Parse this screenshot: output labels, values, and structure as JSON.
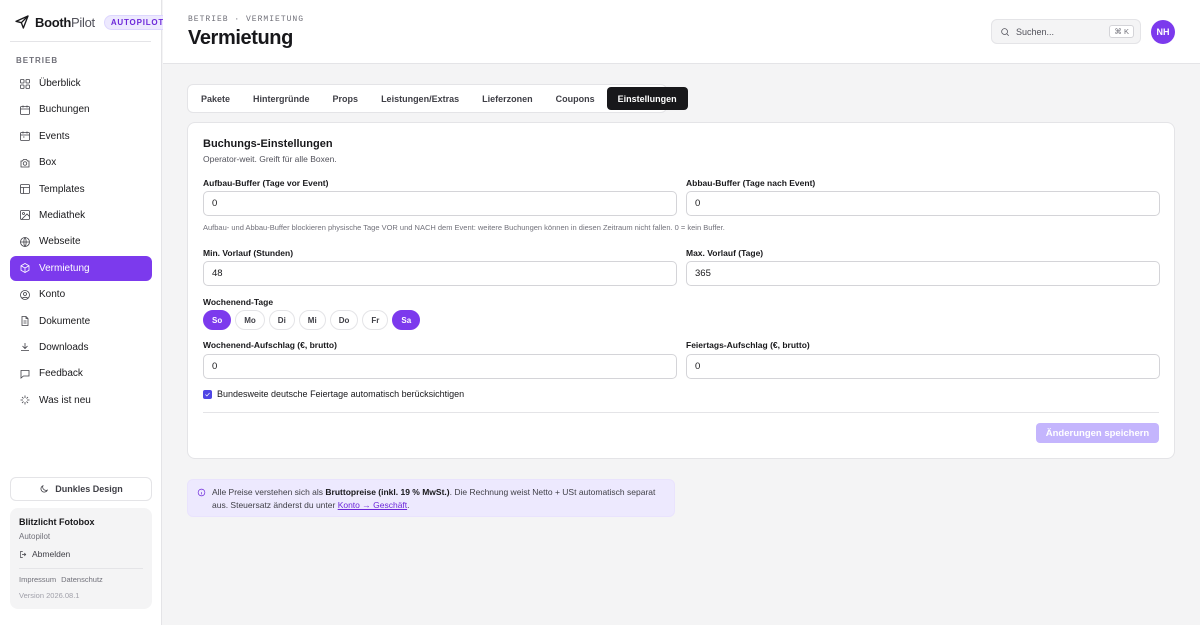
{
  "brand": {
    "name_strong": "Booth",
    "name_light": "Pilot",
    "badge": "AUTOPILOT"
  },
  "sidebar": {
    "section": "BETRIEB",
    "items": [
      {
        "label": "Überblick",
        "icon": "layout-grid-icon",
        "active": false
      },
      {
        "label": "Buchungen",
        "icon": "calendar-icon",
        "active": false
      },
      {
        "label": "Events",
        "icon": "calendar-event-icon",
        "active": false
      },
      {
        "label": "Box",
        "icon": "camera-icon",
        "active": false
      },
      {
        "label": "Templates",
        "icon": "template-icon",
        "active": false
      },
      {
        "label": "Mediathek",
        "icon": "image-icon",
        "active": false
      },
      {
        "label": "Webseite",
        "icon": "globe-icon",
        "active": false
      },
      {
        "label": "Vermietung",
        "icon": "box-icon",
        "active": true
      },
      {
        "label": "Konto",
        "icon": "user-icon",
        "active": false
      },
      {
        "label": "Dokumente",
        "icon": "document-icon",
        "active": false
      },
      {
        "label": "Downloads",
        "icon": "download-icon",
        "active": false
      },
      {
        "label": "Feedback",
        "icon": "message-icon",
        "active": false
      },
      {
        "label": "Was ist neu",
        "icon": "sparkle-icon",
        "active": false
      }
    ],
    "dark_mode_label": "Dunkles Design",
    "account": {
      "name": "Blitzlicht Fotobox",
      "plan": "Autopilot",
      "logout": "Abmelden",
      "link_impressum": "Impressum",
      "link_datenschutz": "Datenschutz",
      "version": "Version 2026.08.1"
    }
  },
  "header": {
    "breadcrumb": "BETRIEB · VERMIETUNG",
    "title": "Vermietung",
    "search_placeholder": "Suchen...",
    "search_shortcut": "⌘ K",
    "avatar_initials": "NH"
  },
  "tabs": [
    {
      "label": "Pakete",
      "active": false
    },
    {
      "label": "Hintergründe",
      "active": false
    },
    {
      "label": "Props",
      "active": false
    },
    {
      "label": "Leistungen/Extras",
      "active": false
    },
    {
      "label": "Lieferzonen",
      "active": false
    },
    {
      "label": "Coupons",
      "active": false
    },
    {
      "label": "Einstellungen",
      "active": true
    }
  ],
  "settings": {
    "title": "Buchungs-Einstellungen",
    "subtitle": "Operator-weit. Greift für alle Boxen.",
    "setup_buffer": {
      "label": "Aufbau-Buffer (Tage vor Event)",
      "value": "0"
    },
    "teardown_buffer": {
      "label": "Abbau-Buffer (Tage nach Event)",
      "value": "0"
    },
    "buffer_hint": "Aufbau- und Abbau-Buffer blockieren physische Tage VOR und NACH dem Event: weitere Buchungen können in diesen Zeitraum nicht fallen. 0 = kein Buffer.",
    "min_lead": {
      "label": "Min. Vorlauf (Stunden)",
      "value": "48"
    },
    "max_lead": {
      "label": "Max. Vorlauf (Tage)",
      "value": "365"
    },
    "weekend_label": "Wochenend-Tage",
    "weekend_days": [
      {
        "label": "So",
        "selected": true
      },
      {
        "label": "Mo",
        "selected": false
      },
      {
        "label": "Di",
        "selected": false
      },
      {
        "label": "Mi",
        "selected": false
      },
      {
        "label": "Do",
        "selected": false
      },
      {
        "label": "Fr",
        "selected": false
      },
      {
        "label": "Sa",
        "selected": true
      }
    ],
    "weekend_surcharge": {
      "label": "Wochenend-Aufschlag (€, brutto)",
      "value": "0"
    },
    "holiday_surcharge": {
      "label": "Feiertags-Aufschlag (€, brutto)",
      "value": "0"
    },
    "holidays_checkbox": {
      "label": "Bundesweite deutsche Feiertage automatisch berücksichtigen",
      "checked": true
    },
    "save_label": "Änderungen speichern"
  },
  "info": {
    "text_1": "Alle Preise verstehen sich als ",
    "text_bold": "Bruttopreise (inkl. 19 % MwSt.)",
    "text_2": ". Die Rechnung weist Netto + USt automatisch separat aus. Steuersatz änderst du unter ",
    "link": "Konto → Geschäft",
    "text_3": "."
  },
  "colors": {
    "accent": "#7c3aed",
    "accent_light": "#ede9fe",
    "tab_active": "#18181b"
  }
}
